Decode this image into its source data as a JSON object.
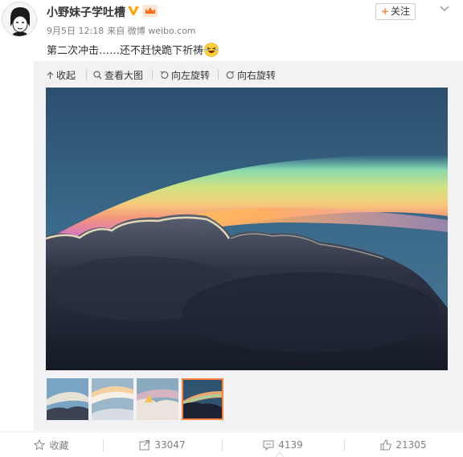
{
  "post": {
    "author": "小野妹子学吐槽",
    "time": "9月5日 12:18",
    "source": "来自 微博 weibo.com",
    "text": "第二次冲击……还不赶快跪下祈祷",
    "follow_label": "关注"
  },
  "media_toolbar": {
    "collapse": "收起",
    "view_large": "查看大图",
    "rotate_left": "向左旋转",
    "rotate_right": "向右旋转"
  },
  "thumbnails": {
    "count": 4,
    "selected_index": 4
  },
  "footer": {
    "favorite": "收藏",
    "repost_count": "33047",
    "comment_count": "4139",
    "like_count": "21305"
  },
  "colors": {
    "accent": "#ff8140",
    "text": "#333333",
    "muted": "#808080"
  },
  "icons": [
    "avatar",
    "verified-v-icon",
    "vip-crown-icon",
    "dropdown-arrow-icon",
    "laugh-emoji",
    "collapse-icon",
    "search-icon",
    "rotate-left-icon",
    "rotate-right-icon",
    "star-icon",
    "share-icon",
    "comment-icon",
    "thumbs-up-icon"
  ]
}
